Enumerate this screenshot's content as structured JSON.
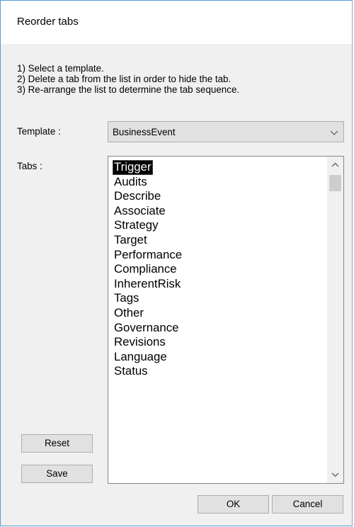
{
  "window": {
    "title": "Reorder tabs"
  },
  "instructions": [
    "1)  Select a template.",
    "2)  Delete a tab from the list in order to hide the tab.",
    "3)  Re-arrange the list to determine the tab sequence."
  ],
  "template": {
    "label": "Template :",
    "selected": "BusinessEvent"
  },
  "tabs": {
    "label": "Tabs :",
    "selected_index": 0,
    "items": [
      "Trigger",
      "Audits",
      "Describe",
      "Associate",
      "Strategy",
      "Target",
      "Performance",
      "Compliance",
      "InherentRisk",
      "Tags",
      "Other",
      "Governance",
      "Revisions",
      "Language",
      "Status"
    ]
  },
  "buttons": {
    "reset": "Reset",
    "save": "Save",
    "ok": "OK",
    "cancel": "Cancel"
  },
  "icons": {
    "combo_arrow": "chevron-down-icon",
    "scroll_up": "chevron-up-icon",
    "scroll_down": "chevron-down-icon"
  },
  "colors": {
    "window_border": "#5b9bd5",
    "selection_bg": "#000000",
    "selection_fg": "#ffffff",
    "button_bg": "#e1e1e1"
  }
}
